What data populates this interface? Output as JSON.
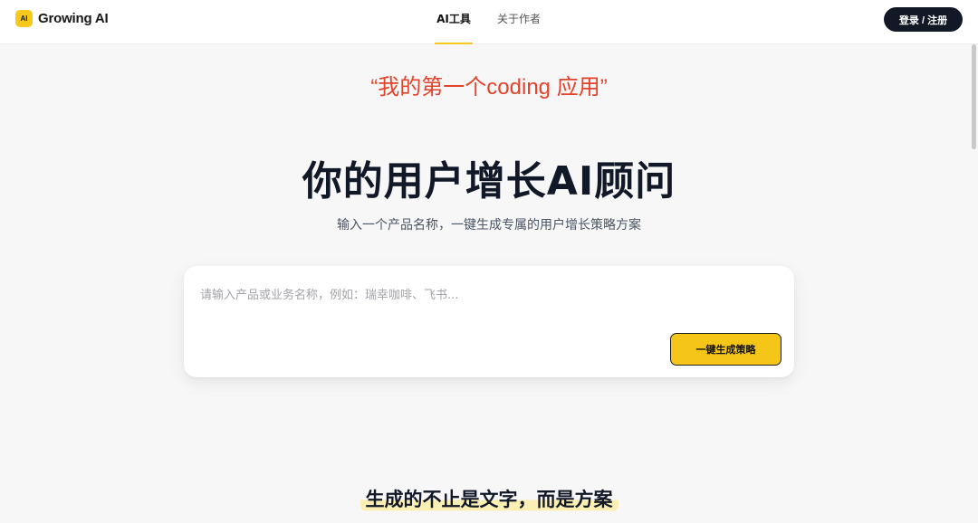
{
  "header": {
    "logo_badge": "AI",
    "brand_name": "Growing AI",
    "nav": [
      {
        "label": "AI工具",
        "active": true
      },
      {
        "label": "关于作者",
        "active": false
      }
    ],
    "login_label": "登录 / 注册"
  },
  "hero": {
    "tagline": "“我的第一个coding 应用”",
    "title": "你的用户增长AI顾问",
    "subtitle": "输入一个产品名称，一键生成专属的用户增长策略方案"
  },
  "input_card": {
    "placeholder": "请输入产品或业务名称，例如：瑞幸咖啡、飞书...",
    "value": "",
    "button_label": "一键生成策略"
  },
  "section": {
    "heading": "生成的不止是文字，而是方案"
  },
  "colors": {
    "accent": "#f7c91c",
    "tagline": "#e2432a",
    "dark_button": "#121826"
  }
}
